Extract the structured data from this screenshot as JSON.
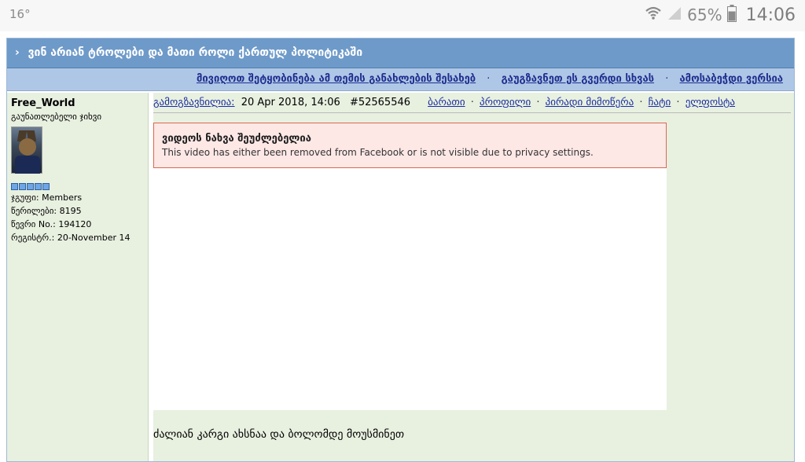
{
  "status_bar": {
    "temperature": "16°",
    "battery_percent": "65%",
    "time": "14:06",
    "icons": [
      "wifi-icon",
      "signal-icon",
      "battery-icon"
    ]
  },
  "topic": {
    "title_prefix": "›",
    "title": "ვინ არიან ტროლები და მათი როლი ქართულ პოლიტიკაში"
  },
  "options": {
    "notify": "მივიღოთ შეტყობინება ამ თემის განახლების შესახებ",
    "separator": "·",
    "send_page": "გაუგზავნეთ ეს გვერდი სხვას",
    "print_version": "ამოსაბეჭდი ვერსია"
  },
  "author": {
    "name": "Free_World",
    "title": "გაუნათლებელი ჯიხვი",
    "pips": 5,
    "group": "ჯგუფი: Members",
    "posts": "წერილები: 8195",
    "member_no": "წევრი No.: 194120",
    "registered": "რეგისტრ.: 20-November 14"
  },
  "post": {
    "sent_label": "გამოგზავნილია:",
    "date": "20 Apr 2018, 14:06",
    "post_id": "#52565546",
    "links": {
      "card": "ბარათი",
      "profile": "პროფილი",
      "pm": "პირადი მიმოწერა",
      "chat": "ჩატი",
      "elfosta": "ელფოსტა"
    },
    "dot": "·",
    "video_error_title": "ვიდეოს ნახვა შეუძლებელია",
    "video_error_desc": "This video has either been removed from Facebook or is not visible due to privacy settings.",
    "text": "ძალიან კარგი ახსნაა და ბოლომდე მოუსმინეთ"
  },
  "colors": {
    "title_bar": "#6e9ac9",
    "options_bar": "#afc7e6",
    "post_bg": "#e8f0e0",
    "link": "#1a2ca0",
    "error_bg": "#fde8e6",
    "error_border": "#d8694f"
  }
}
